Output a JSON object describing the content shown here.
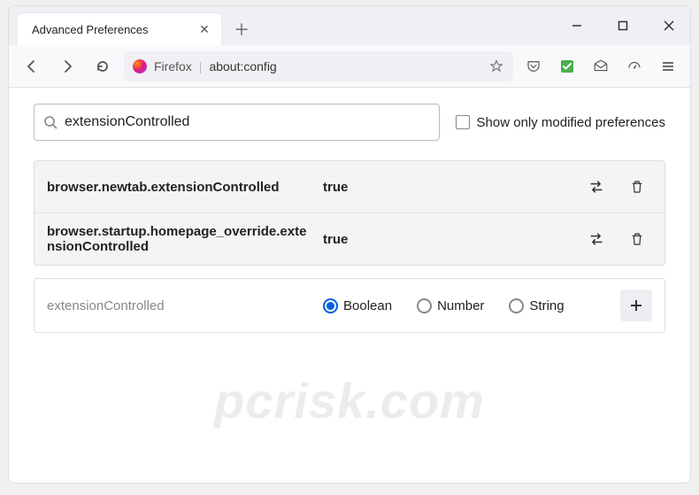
{
  "tab": {
    "title": "Advanced Preferences"
  },
  "addressbar": {
    "label": "Firefox",
    "url": "about:config"
  },
  "search": {
    "value": "extensionControlled",
    "checkbox_label": "Show only modified preferences"
  },
  "prefs": [
    {
      "name": "browser.newtab.extensionControlled",
      "value": "true"
    },
    {
      "name": "browser.startup.homepage_override.extensionControlled",
      "value": "true"
    }
  ],
  "new_pref": {
    "name": "extensionControlled",
    "types": {
      "boolean": "Boolean",
      "number": "Number",
      "string": "String"
    },
    "selected": "boolean"
  },
  "watermark": "pcrisk.com"
}
